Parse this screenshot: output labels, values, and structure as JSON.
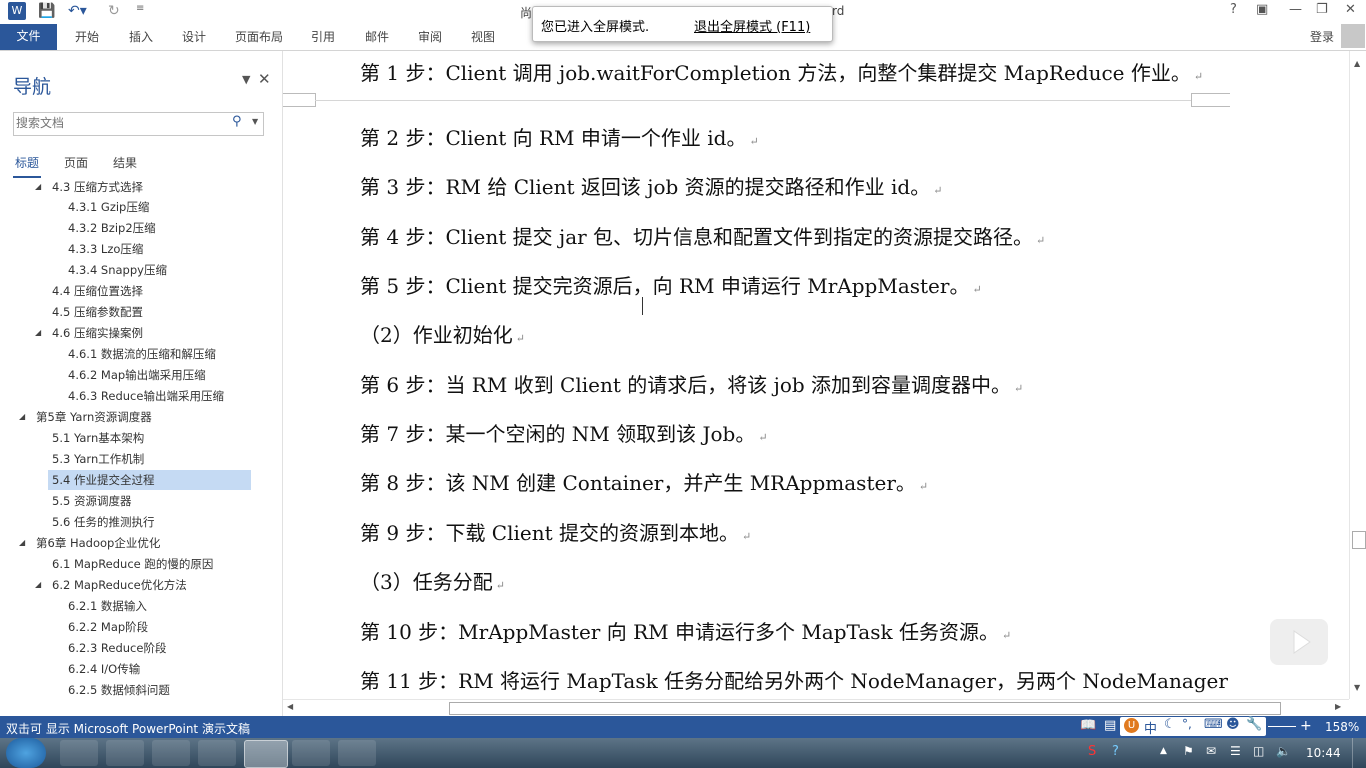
{
  "window": {
    "title_visible": "尚",
    "title_tail": "rd",
    "help": "?",
    "login": "登录",
    "fullscreen_toast": {
      "message": "您已进入全屏模式.",
      "exit_link": "退出全屏模式 (F11)"
    }
  },
  "ribbon": {
    "file_tab": "文件",
    "tabs": [
      "开始",
      "插入",
      "设计",
      "页面布局",
      "引用",
      "邮件",
      "审阅",
      "视图"
    ]
  },
  "nav": {
    "title": "导航",
    "search_placeholder": "搜索文档",
    "tabs": [
      "标题",
      "页面",
      "结果"
    ],
    "items": [
      {
        "label": "4.3 压缩方式选择"
      },
      {
        "label": "4.3.1 Gzip压缩"
      },
      {
        "label": "4.3.2 Bzip2压缩"
      },
      {
        "label": "4.3.3 Lzo压缩"
      },
      {
        "label": "4.3.4 Snappy压缩"
      },
      {
        "label": "4.4 压缩位置选择"
      },
      {
        "label": "4.5 压缩参数配置"
      },
      {
        "label": "4.6 压缩实操案例"
      },
      {
        "label": "4.6.1 数据流的压缩和解压缩"
      },
      {
        "label": "4.6.2 Map输出端采用压缩"
      },
      {
        "label": "4.6.3 Reduce输出端采用压缩"
      },
      {
        "label": "第5章 Yarn资源调度器"
      },
      {
        "label": "5.1 Yarn基本架构"
      },
      {
        "label": "5.3 Yarn工作机制"
      },
      {
        "label": "5.4 作业提交全过程"
      },
      {
        "label": "5.5 资源调度器"
      },
      {
        "label": "5.6 任务的推测执行"
      },
      {
        "label": "第6章 Hadoop企业优化"
      },
      {
        "label": "6.1 MapReduce 跑的慢的原因"
      },
      {
        "label": "6.2 MapReduce优化方法"
      },
      {
        "label": "6.2.1 数据输入"
      },
      {
        "label": "6.2.2 Map阶段"
      },
      {
        "label": "6.2.3 Reduce阶段"
      },
      {
        "label": "6.2.4 I/O传输"
      },
      {
        "label": "6.2.5 数据倾斜问题"
      }
    ]
  },
  "document": {
    "paragraphs": [
      "第 1 步：Client 调用 job.waitForCompletion 方法，向整个集群提交 MapReduce 作业。",
      "第 2 步：Client 向 RM 申请一个作业 id。",
      "第 3 步：RM 给 Client 返回该 job 资源的提交路径和作业 id。",
      "第 4 步：Client 提交 jar 包、切片信息和配置文件到指定的资源提交路径。",
      "第 5 步：Client 提交完资源后，向 RM 申请运行 MrAppMaster。",
      "（2）作业初始化",
      "第 6 步：当 RM 收到 Client 的请求后，将该 job 添加到容量调度器中。",
      "第 7 步：某一个空闲的 NM 领取到该 Job。",
      "第 8 步：该 NM 创建 Container，并产生 MRAppmaster。",
      "第 9 步：下载 Client 提交的资源到本地。",
      "（3）任务分配",
      "第 10 步：MrAppMaster 向 RM 申请运行多个 MapTask 任务资源。",
      "第 11 步：RM 将运行 MapTask 任务分配给另外两个 NodeManager，另两个 NodeManager"
    ]
  },
  "status": {
    "left": "双击可 显示 Microsoft PowerPoint 演示文稿",
    "ime": "中",
    "zoom": "158%"
  },
  "taskbar": {
    "time": "10:44"
  }
}
